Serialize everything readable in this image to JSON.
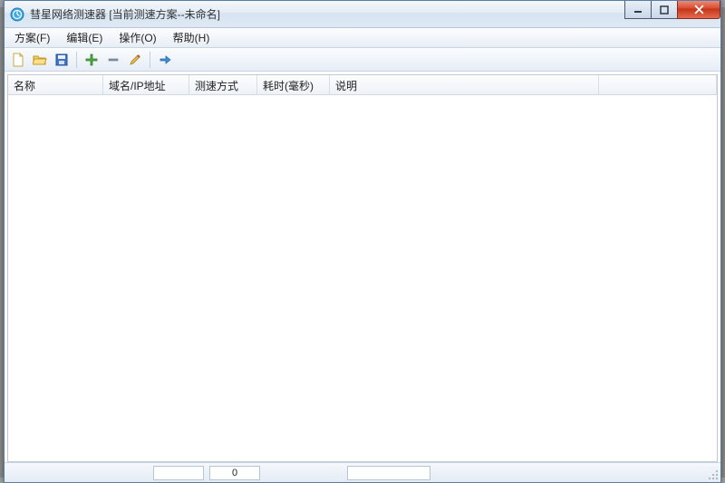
{
  "title": "彗星网络测速器 [当前测速方案--未命名]",
  "menus": {
    "scheme": "方案(F)",
    "edit": "编辑(E)",
    "action": "操作(O)",
    "help": "帮助(H)"
  },
  "toolbar_icons": {
    "new": "new-file-icon",
    "open": "folder-open-icon",
    "save": "save-icon",
    "add": "plus-icon",
    "remove": "minus-icon",
    "edit": "pencil-icon",
    "go": "arrow-right-icon"
  },
  "columns": {
    "name": "名称",
    "host": "域名/IP地址",
    "method": "测速方式",
    "time": "耗时(毫秒)",
    "desc": "说明"
  },
  "status": {
    "pane1": "",
    "pane2": "0",
    "pane3": ""
  }
}
